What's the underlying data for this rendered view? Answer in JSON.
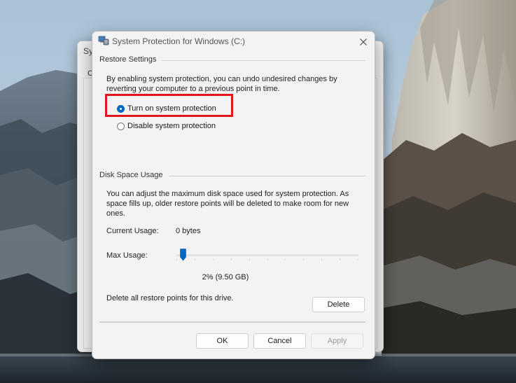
{
  "behind_window": {
    "title": "Sy",
    "tab": "C"
  },
  "dialog": {
    "title": "System Protection for Windows (C:)",
    "close_icon": "close-icon",
    "title_icon": "system-protection-icon"
  },
  "restore_settings": {
    "group_label": "Restore Settings",
    "description": "By enabling system protection, you can undo undesired changes by reverting your computer to a previous point in time.",
    "options": [
      {
        "label": "Turn on system protection",
        "selected": true
      },
      {
        "label": "Disable system protection",
        "selected": false
      }
    ]
  },
  "disk_space": {
    "group_label": "Disk Space Usage",
    "description": "You can adjust the maximum disk space used for system protection. As space fills up, older restore points will be deleted to make room for new ones.",
    "current_usage_label": "Current Usage:",
    "current_usage_value": "0 bytes",
    "max_usage_label": "Max Usage:",
    "max_usage_percent": 2,
    "max_usage_readout": "2% (9.50 GB)",
    "delete_text": "Delete all restore points for this drive.",
    "delete_button": "Delete"
  },
  "footer": {
    "ok": "OK",
    "cancel": "Cancel",
    "apply": "Apply"
  },
  "colors": {
    "accent": "#0067c0",
    "highlight": "#e3151c"
  }
}
